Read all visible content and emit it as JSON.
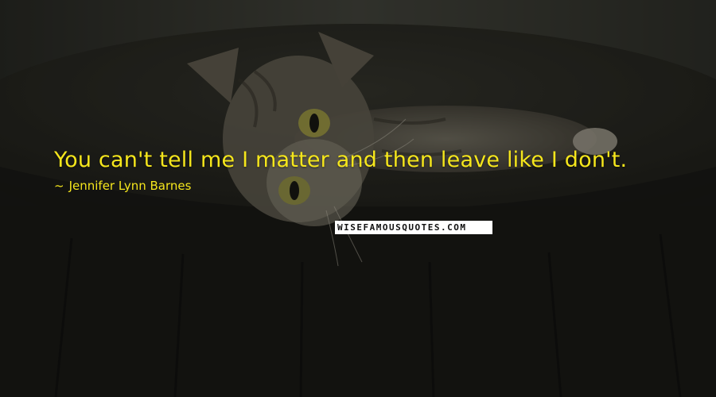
{
  "quote": {
    "text": "You can't tell me I matter and then leave like I don't.",
    "author_dash": "~",
    "author": "Jennifer Lynn Barnes"
  },
  "watermark": {
    "text": "WISEFAMOUSQUOTES.COM"
  },
  "colors": {
    "quote_text": "#f5e61c",
    "background": "#2a2a24"
  },
  "image": {
    "subject": "kitten lying on a dark wooden barrel"
  }
}
